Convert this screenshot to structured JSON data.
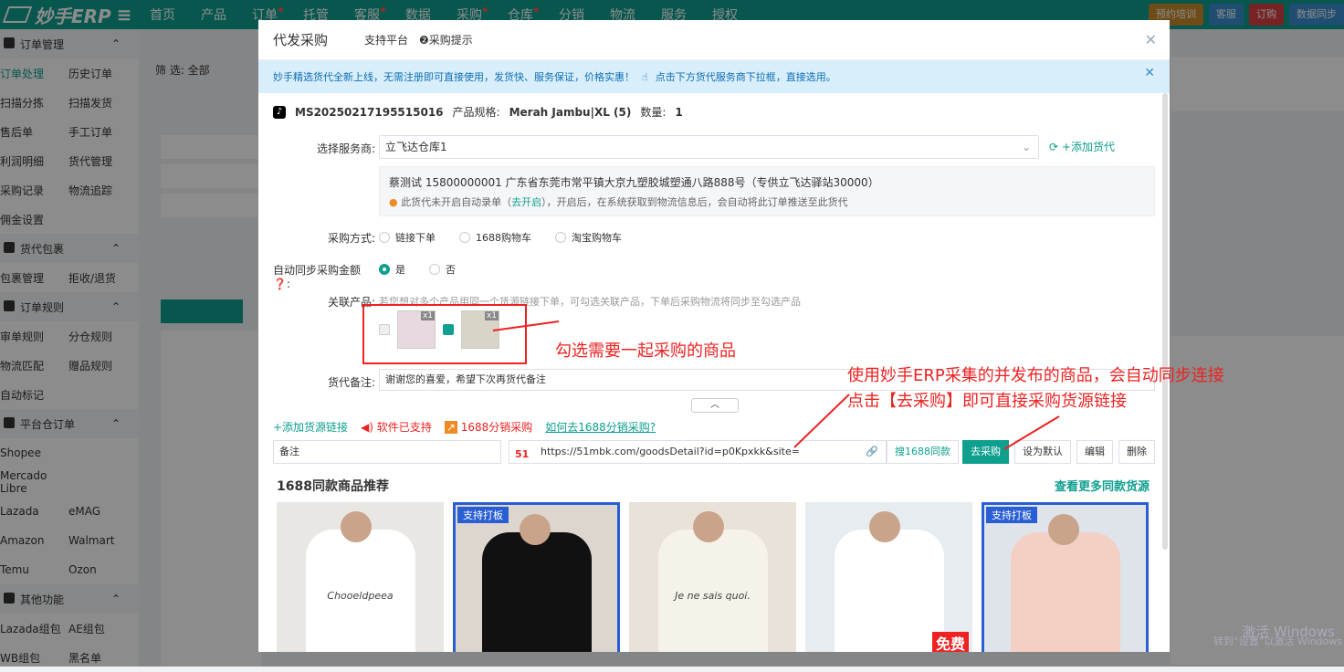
{
  "topbar": {
    "logo": "妙手ERP",
    "nav": [
      "首页",
      "产品",
      "订单",
      "托管",
      "客服",
      "数据",
      "采购",
      "仓库",
      "分销",
      "物流",
      "服务",
      "授权"
    ],
    "right": [
      "预约培训",
      "客服",
      "订购",
      "数据同步"
    ]
  },
  "sidebar": {
    "groups": [
      {
        "title": "订单管理",
        "rows": [
          [
            "订单处理",
            "历史订单"
          ],
          [
            "扫描分拣",
            "扫描发货"
          ],
          [
            "售后单",
            "手工订单"
          ],
          [
            "利润明细",
            "货代管理"
          ],
          [
            "采购记录",
            "物流追踪"
          ],
          [
            "佣金设置",
            ""
          ]
        ]
      },
      {
        "title": "货代包裹",
        "rows": [
          [
            "包裹管理",
            "拒收/退货"
          ]
        ]
      },
      {
        "title": "订单规则",
        "rows": [
          [
            "审单规则",
            "分仓规则"
          ],
          [
            "物流匹配",
            "赠品规则"
          ],
          [
            "自动标记",
            ""
          ]
        ]
      },
      {
        "title": "平台仓订单",
        "rows": [
          [
            "Shopee",
            ""
          ],
          [
            "Mercado Libre",
            ""
          ],
          [
            "Lazada",
            "eMAG"
          ],
          [
            "Amazon",
            "Walmart"
          ],
          [
            "Temu",
            "Ozon"
          ]
        ]
      },
      {
        "title": "其他功能",
        "rows": [
          [
            "Lazada组包",
            "AE组包"
          ],
          [
            "WB组包",
            "黑名单"
          ]
        ]
      }
    ]
  },
  "dialog": {
    "title": "代发采购",
    "support": "支持平台",
    "tip": "采购提示",
    "notice": "妙手精选货代全新上线，无需注册即可直接使用，发货快、服务保证，价格实惠！",
    "notice_link": "点击下方货代服务商下拉框，直接选用。",
    "order_no": "MS20250217195515016",
    "spec_label": "产品规格:",
    "spec": "Merah Jambu|XL (5)",
    "qty_label": "数量:",
    "qty": "1",
    "provider_label": "选择服务商:",
    "provider": "立飞达仓库1",
    "add_forwarder": "+添加货代",
    "address": "蔡测试 15800000001 广东省东莞市常平镇大京九塑胶城塑通八路888号（专供立飞达驿站30000）",
    "warn": "此货代未开启自动录单（",
    "warn_link": "去开启",
    "warn2": "），开启后，在系统获取到物流信息后，会自动将此订单推送至此货代",
    "method_label": "采购方式:",
    "methods": [
      "链接下单",
      "1688购物车",
      "淘宝购物车"
    ],
    "sync_label": "自动同步采购金额",
    "sync_yes": "是",
    "sync_no": "否",
    "related_label": "关联产品:",
    "related_tip": "若您想对多个产品用同一个货源链接下单，可勾选关联产品，下单后采购物流将同步至勾选产品",
    "thumb_badge": "x1",
    "annot1": "勾选需要一起采购的商品",
    "annot2": "使用妙手ERP采集的并发布的商品，会自动同步连接",
    "annot3": "点击【去采购】即可直接采购货源链接",
    "remark_label": "货代备注:",
    "remark": "谢谢您的喜爱，希望下次再货代备注",
    "add_source": "+添加货源链接",
    "software": "软件已支持",
    "fx": "1688分销采购",
    "how": "如何去1688分销采购?",
    "note_placeholder": "备注",
    "url": "https://51mbk.com/goodsDetail?id=p0Kpxkk&site=",
    "search1688": "搜1688同款",
    "go_buy": "去采购",
    "set_default": "设为默认",
    "edit": "编辑",
    "delete": "删除",
    "rec_title": "1688同款商品推荐",
    "more": "查看更多同款货源",
    "products": [
      {
        "tag": "",
        "print": "Chooeldpeea"
      },
      {
        "tag": "支持打板",
        "print": ""
      },
      {
        "tag": "",
        "print": "Je ne sais quoi."
      },
      {
        "tag": "",
        "print": "",
        "free": "免费"
      },
      {
        "tag": "支持打板",
        "print": ""
      }
    ]
  },
  "watermark": {
    "line1": "激活 Windows",
    "line2": "转到“设置”以激活 Windows"
  }
}
